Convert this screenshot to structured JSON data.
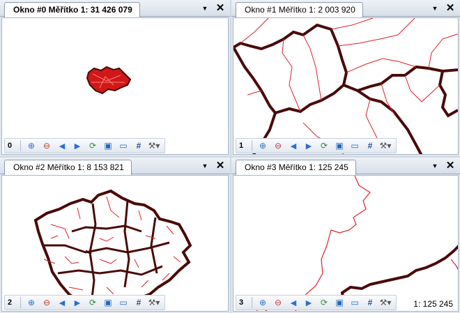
{
  "windows": [
    {
      "id": 0,
      "tab_title": "Okno #0 Měřítko 1: 31 426 079",
      "number": "0",
      "active": true,
      "scale_readout": ""
    },
    {
      "id": 1,
      "tab_title": "Okno #1 Měřítko 1: 2 003 920",
      "number": "1",
      "active": false,
      "scale_readout": ""
    },
    {
      "id": 2,
      "tab_title": "Okno #2 Měřítko 1: 8 153 821",
      "number": "2",
      "active": false,
      "scale_readout": ""
    },
    {
      "id": 3,
      "tab_title": "Okno #3 Měřítko 1:  125 245",
      "number": "3",
      "active": false,
      "scale_readout": "1:  125 245"
    }
  ],
  "tab_controls": {
    "dropdown_glyph": "▼",
    "close_glyph": "✕"
  },
  "toolbar_icons": [
    "zoom-in-icon",
    "zoom-out-icon",
    "back-arrow-icon",
    "forward-arrow-icon",
    "refresh-map-icon",
    "image-icon",
    "layer-icon",
    "grid-icon",
    "tools-icon"
  ],
  "colors": {
    "border_thick": "#4a0a0a",
    "border_thin": "#e0202a",
    "tab_bg": "#ffffff",
    "map_bg": "#ffffff"
  }
}
